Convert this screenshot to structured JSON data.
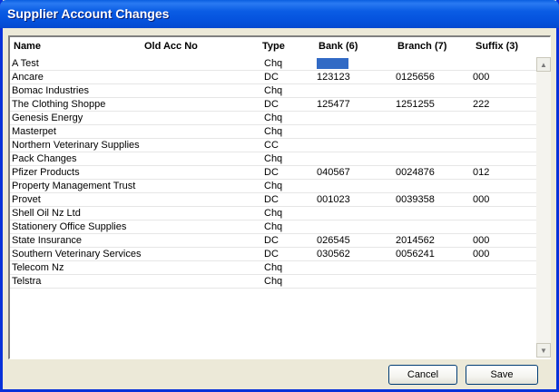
{
  "window": {
    "title": "Supplier Account Changes"
  },
  "columns": {
    "name": "Name",
    "old_acc_no": "Old Acc No",
    "type": "Type",
    "bank": "Bank (6)",
    "branch": "Branch (7)",
    "suffix": "Suffix (3)"
  },
  "rows": [
    {
      "name": "A Test",
      "type": "Chq",
      "bank": "",
      "branch": "",
      "suffix": ""
    },
    {
      "name": "Ancare",
      "type": "DC",
      "bank": "123123",
      "branch": "0125656",
      "suffix": "000"
    },
    {
      "name": "Bomac Industries",
      "type": "Chq",
      "bank": "",
      "branch": "",
      "suffix": ""
    },
    {
      "name": "The Clothing Shoppe",
      "type": "DC",
      "bank": "125477",
      "branch": "1251255",
      "suffix": "222"
    },
    {
      "name": "Genesis Energy",
      "type": "Chq",
      "bank": "",
      "branch": "",
      "suffix": ""
    },
    {
      "name": "Masterpet",
      "type": "Chq",
      "bank": "",
      "branch": "",
      "suffix": ""
    },
    {
      "name": "Northern Veterinary Supplies",
      "type": "CC",
      "bank": "",
      "branch": "",
      "suffix": ""
    },
    {
      "name": "Pack Changes",
      "type": "Chq",
      "bank": "",
      "branch": "",
      "suffix": ""
    },
    {
      "name": "Pfizer Products",
      "type": "DC",
      "bank": "040567",
      "branch": "0024876",
      "suffix": "012"
    },
    {
      "name": "Property Management Trust",
      "type": "Chq",
      "bank": "",
      "branch": "",
      "suffix": ""
    },
    {
      "name": "Provet",
      "type": "DC",
      "bank": "001023",
      "branch": "0039358",
      "suffix": "000"
    },
    {
      "name": "Shell Oil Nz Ltd",
      "type": "Chq",
      "bank": "",
      "branch": "",
      "suffix": ""
    },
    {
      "name": "Stationery Office Supplies",
      "type": "Chq",
      "bank": "",
      "branch": "",
      "suffix": ""
    },
    {
      "name": "State Insurance",
      "type": "DC",
      "bank": "026545",
      "branch": "2014562",
      "suffix": "000"
    },
    {
      "name": "Southern Veterinary Services",
      "type": "DC",
      "bank": "030562",
      "branch": "0056241",
      "suffix": "000"
    },
    {
      "name": "Telecom Nz",
      "type": "Chq",
      "bank": "",
      "branch": "",
      "suffix": ""
    },
    {
      "name": "Telstra",
      "type": "Chq",
      "bank": "",
      "branch": "",
      "suffix": ""
    }
  ],
  "buttons": {
    "cancel": "Cancel",
    "save": "Save"
  },
  "icons": {
    "scroll_up": "scroll-up-arrow-icon",
    "scroll_down": "scroll-down-arrow-icon"
  },
  "colors": {
    "title_bar": "#0a5ce4",
    "selection": "#316ac5",
    "window_bg": "#ece9d8"
  }
}
